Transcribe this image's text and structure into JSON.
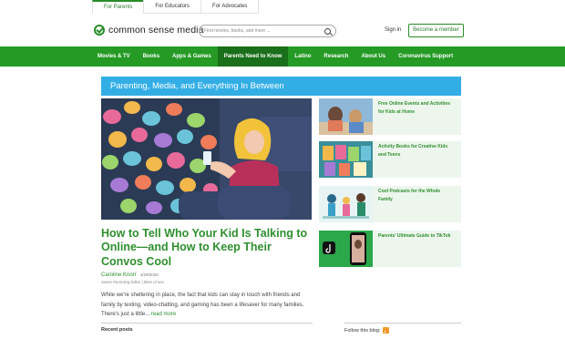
{
  "audience_tabs": [
    "For Parents",
    "For Educators",
    "For Advocates"
  ],
  "header": {
    "logo_text": "common sense media",
    "search_placeholder": "Find movies, books, and more ...",
    "sign_in": "Sign in",
    "member_button": "Become a member"
  },
  "nav": [
    "Movies & TV",
    "Books",
    "Apps & Games",
    "Parents Need to Know",
    "Latino",
    "Research",
    "About Us",
    "Coronavirus Support"
  ],
  "blog": {
    "title": "Parenting, Media, and Everything In Between"
  },
  "hero": {
    "title": "How to Tell Who Your Kid Is Talking to Online—and How to Keep Their Convos Cool",
    "author": "Caroline Knorr",
    "date": "4/29/2020",
    "role": "Senior Parenting Editor | Mom of one",
    "excerpt": "While we're sheltering in place, the fact that kids can stay in touch with friends and family by texting, video-chatting, and gaming has been a lifesaver for many families. There's just a little...",
    "read_more": "read more"
  },
  "sidebar": [
    {
      "title": "Free Online Events and Activities for Kids at Home"
    },
    {
      "title": "Activity Books for Creative Kids and Teens"
    },
    {
      "title": "Cool Podcasts for the Whole Family"
    },
    {
      "title": "Parents' Ultimate Guide to TikTok"
    }
  ],
  "footer": {
    "recent_posts": "Recent posts",
    "follow": "Follow this blog:"
  },
  "colors": {
    "brand_green": "#259a25",
    "link_green": "#2f8f2f",
    "blog_blue": "#33aee5",
    "card_bg": "#edf6ed"
  }
}
